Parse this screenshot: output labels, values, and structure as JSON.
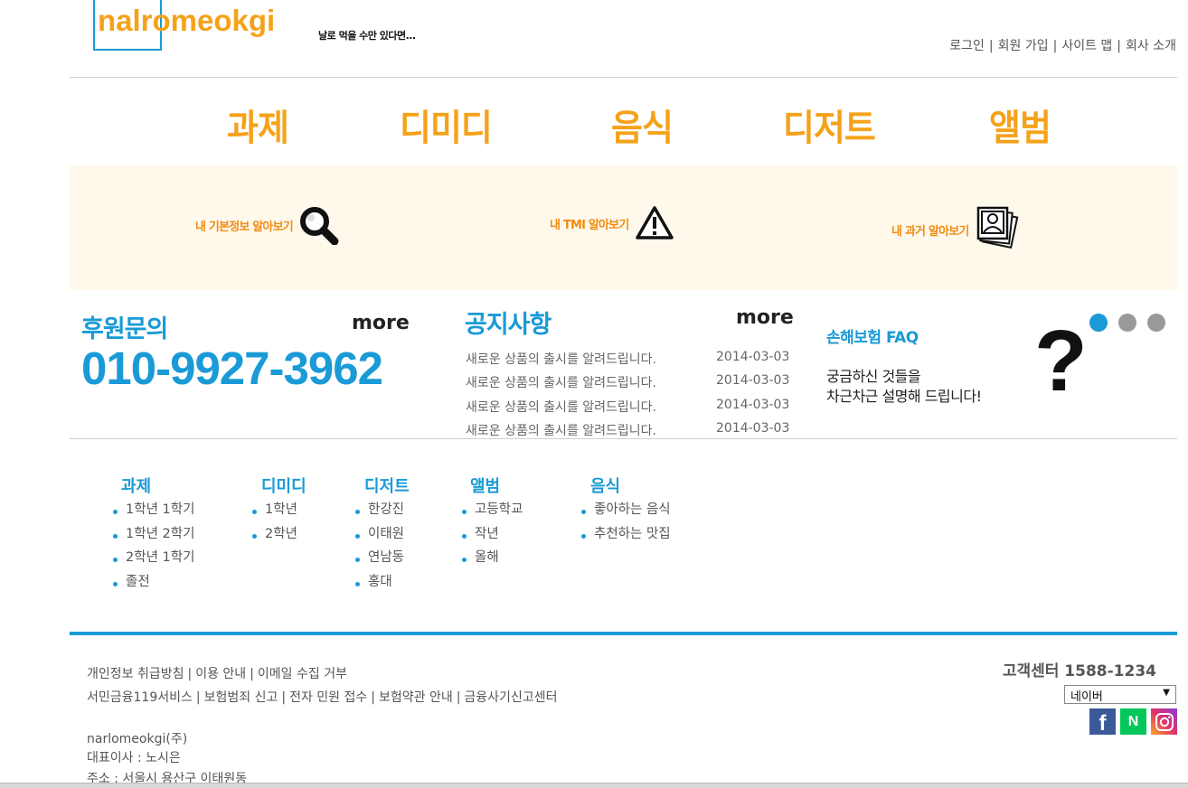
{
  "header": {
    "logo_text": "nalromeokgi",
    "tagline": "날로 먹을 수만 있다면...",
    "top_links": [
      "로그인",
      "회원 가입",
      "사이트 맵",
      "회사 소개"
    ]
  },
  "nav": [
    "과제",
    "디미디",
    "음식",
    "디저트",
    "앨범"
  ],
  "banner": [
    {
      "label": "내 기본정보 알아보기",
      "icon": "magnifier-icon"
    },
    {
      "label": "내 TMI 알아보기",
      "icon": "warning-icon"
    },
    {
      "label": "내 과거 알아보기",
      "icon": "photos-icon"
    }
  ],
  "sponsor": {
    "title": "후원문의",
    "more": "more",
    "phone": "010-9927-3962"
  },
  "notice": {
    "title": "공지사항",
    "more": "more",
    "items": [
      {
        "text": "새로운 상품의 출시를 알려드립니다.",
        "date": "2014-03-03"
      },
      {
        "text": "새로운 상품의 출시를 알려드립니다.",
        "date": "2014-03-03"
      },
      {
        "text": "새로운 상품의 출시를 알려드립니다.",
        "date": "2014-03-03"
      },
      {
        "text": "새로운 상품의 출시를 알려드립니다.",
        "date": "2014-03-03"
      }
    ]
  },
  "faq": {
    "title": "손해보험 FAQ",
    "line1": "궁금하신 것들을",
    "line2": "차근차근 설명해 드립니다!",
    "symbol": "?",
    "slider_dots": {
      "count": 3,
      "active": 0
    }
  },
  "sitemap": [
    {
      "heading": "과제",
      "items": [
        "1학년 1학기",
        "1학년 2학기",
        "2학년 1학기",
        "졸전"
      ]
    },
    {
      "heading": "디미디",
      "items": [
        "1학년",
        "2학년"
      ]
    },
    {
      "heading": "디저트",
      "items": [
        "한강진",
        "이태원",
        "연남동",
        "홍대"
      ]
    },
    {
      "heading": "앨범",
      "items": [
        "고등학교",
        "작년",
        "올해"
      ]
    },
    {
      "heading": "음식",
      "items": [
        "좋아하는 음식",
        "추천하는 맛집"
      ]
    }
  ],
  "footer": {
    "links_row1": [
      "개인정보 취급방침",
      "이용 안내",
      "이메일 수집 거부"
    ],
    "links_row2": [
      "서민금융119서비스",
      "보험범죄 신고",
      "전자 민원 접수",
      "보험약관 안내",
      "금융사기신고센터"
    ],
    "company": "narlomeokgi(주)",
    "ceo": "대표이사 : 노시은",
    "address": "주소 : 서울시 용산구 이태원동",
    "customer_center": "고객센터 1588-1234",
    "select_value": "네이버",
    "sns": [
      {
        "name": "facebook-icon",
        "letter": "f",
        "color": "#3b5998"
      },
      {
        "name": "naver-icon",
        "letter": "N",
        "color": "#03c75a"
      },
      {
        "name": "instagram-icon",
        "letter": "",
        "color": "#e1306c"
      }
    ]
  },
  "colors": {
    "accent_blue": "#1a9ad6",
    "accent_orange": "#f5a21a",
    "banner_bg": "#fff9ec"
  }
}
